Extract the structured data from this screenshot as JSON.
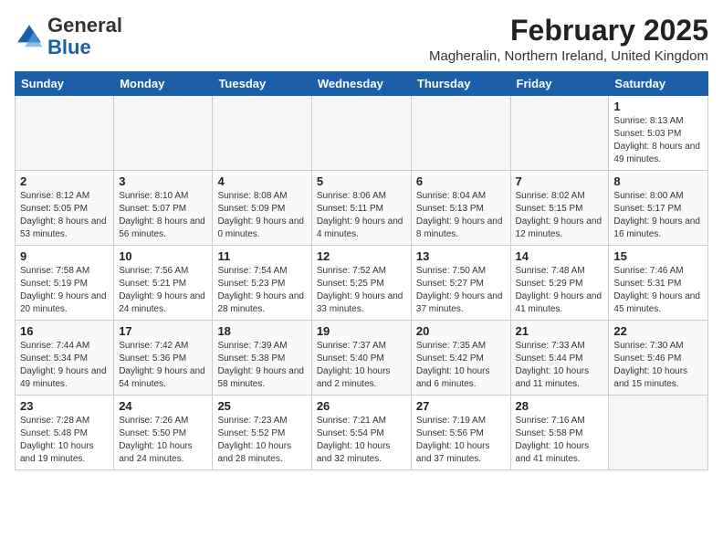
{
  "logo": {
    "general": "General",
    "blue": "Blue"
  },
  "header": {
    "title": "February 2025",
    "location": "Magheralin, Northern Ireland, United Kingdom"
  },
  "weekdays": [
    "Sunday",
    "Monday",
    "Tuesday",
    "Wednesday",
    "Thursday",
    "Friday",
    "Saturday"
  ],
  "weeks": [
    [
      {
        "day": "",
        "info": ""
      },
      {
        "day": "",
        "info": ""
      },
      {
        "day": "",
        "info": ""
      },
      {
        "day": "",
        "info": ""
      },
      {
        "day": "",
        "info": ""
      },
      {
        "day": "",
        "info": ""
      },
      {
        "day": "1",
        "info": "Sunrise: 8:13 AM\nSunset: 5:03 PM\nDaylight: 8 hours and 49 minutes."
      }
    ],
    [
      {
        "day": "2",
        "info": "Sunrise: 8:12 AM\nSunset: 5:05 PM\nDaylight: 8 hours and 53 minutes."
      },
      {
        "day": "3",
        "info": "Sunrise: 8:10 AM\nSunset: 5:07 PM\nDaylight: 8 hours and 56 minutes."
      },
      {
        "day": "4",
        "info": "Sunrise: 8:08 AM\nSunset: 5:09 PM\nDaylight: 9 hours and 0 minutes."
      },
      {
        "day": "5",
        "info": "Sunrise: 8:06 AM\nSunset: 5:11 PM\nDaylight: 9 hours and 4 minutes."
      },
      {
        "day": "6",
        "info": "Sunrise: 8:04 AM\nSunset: 5:13 PM\nDaylight: 9 hours and 8 minutes."
      },
      {
        "day": "7",
        "info": "Sunrise: 8:02 AM\nSunset: 5:15 PM\nDaylight: 9 hours and 12 minutes."
      },
      {
        "day": "8",
        "info": "Sunrise: 8:00 AM\nSunset: 5:17 PM\nDaylight: 9 hours and 16 minutes."
      }
    ],
    [
      {
        "day": "9",
        "info": "Sunrise: 7:58 AM\nSunset: 5:19 PM\nDaylight: 9 hours and 20 minutes."
      },
      {
        "day": "10",
        "info": "Sunrise: 7:56 AM\nSunset: 5:21 PM\nDaylight: 9 hours and 24 minutes."
      },
      {
        "day": "11",
        "info": "Sunrise: 7:54 AM\nSunset: 5:23 PM\nDaylight: 9 hours and 28 minutes."
      },
      {
        "day": "12",
        "info": "Sunrise: 7:52 AM\nSunset: 5:25 PM\nDaylight: 9 hours and 33 minutes."
      },
      {
        "day": "13",
        "info": "Sunrise: 7:50 AM\nSunset: 5:27 PM\nDaylight: 9 hours and 37 minutes."
      },
      {
        "day": "14",
        "info": "Sunrise: 7:48 AM\nSunset: 5:29 PM\nDaylight: 9 hours and 41 minutes."
      },
      {
        "day": "15",
        "info": "Sunrise: 7:46 AM\nSunset: 5:31 PM\nDaylight: 9 hours and 45 minutes."
      }
    ],
    [
      {
        "day": "16",
        "info": "Sunrise: 7:44 AM\nSunset: 5:34 PM\nDaylight: 9 hours and 49 minutes."
      },
      {
        "day": "17",
        "info": "Sunrise: 7:42 AM\nSunset: 5:36 PM\nDaylight: 9 hours and 54 minutes."
      },
      {
        "day": "18",
        "info": "Sunrise: 7:39 AM\nSunset: 5:38 PM\nDaylight: 9 hours and 58 minutes."
      },
      {
        "day": "19",
        "info": "Sunrise: 7:37 AM\nSunset: 5:40 PM\nDaylight: 10 hours and 2 minutes."
      },
      {
        "day": "20",
        "info": "Sunrise: 7:35 AM\nSunset: 5:42 PM\nDaylight: 10 hours and 6 minutes."
      },
      {
        "day": "21",
        "info": "Sunrise: 7:33 AM\nSunset: 5:44 PM\nDaylight: 10 hours and 11 minutes."
      },
      {
        "day": "22",
        "info": "Sunrise: 7:30 AM\nSunset: 5:46 PM\nDaylight: 10 hours and 15 minutes."
      }
    ],
    [
      {
        "day": "23",
        "info": "Sunrise: 7:28 AM\nSunset: 5:48 PM\nDaylight: 10 hours and 19 minutes."
      },
      {
        "day": "24",
        "info": "Sunrise: 7:26 AM\nSunset: 5:50 PM\nDaylight: 10 hours and 24 minutes."
      },
      {
        "day": "25",
        "info": "Sunrise: 7:23 AM\nSunset: 5:52 PM\nDaylight: 10 hours and 28 minutes."
      },
      {
        "day": "26",
        "info": "Sunrise: 7:21 AM\nSunset: 5:54 PM\nDaylight: 10 hours and 32 minutes."
      },
      {
        "day": "27",
        "info": "Sunrise: 7:19 AM\nSunset: 5:56 PM\nDaylight: 10 hours and 37 minutes."
      },
      {
        "day": "28",
        "info": "Sunrise: 7:16 AM\nSunset: 5:58 PM\nDaylight: 10 hours and 41 minutes."
      },
      {
        "day": "",
        "info": ""
      }
    ]
  ]
}
